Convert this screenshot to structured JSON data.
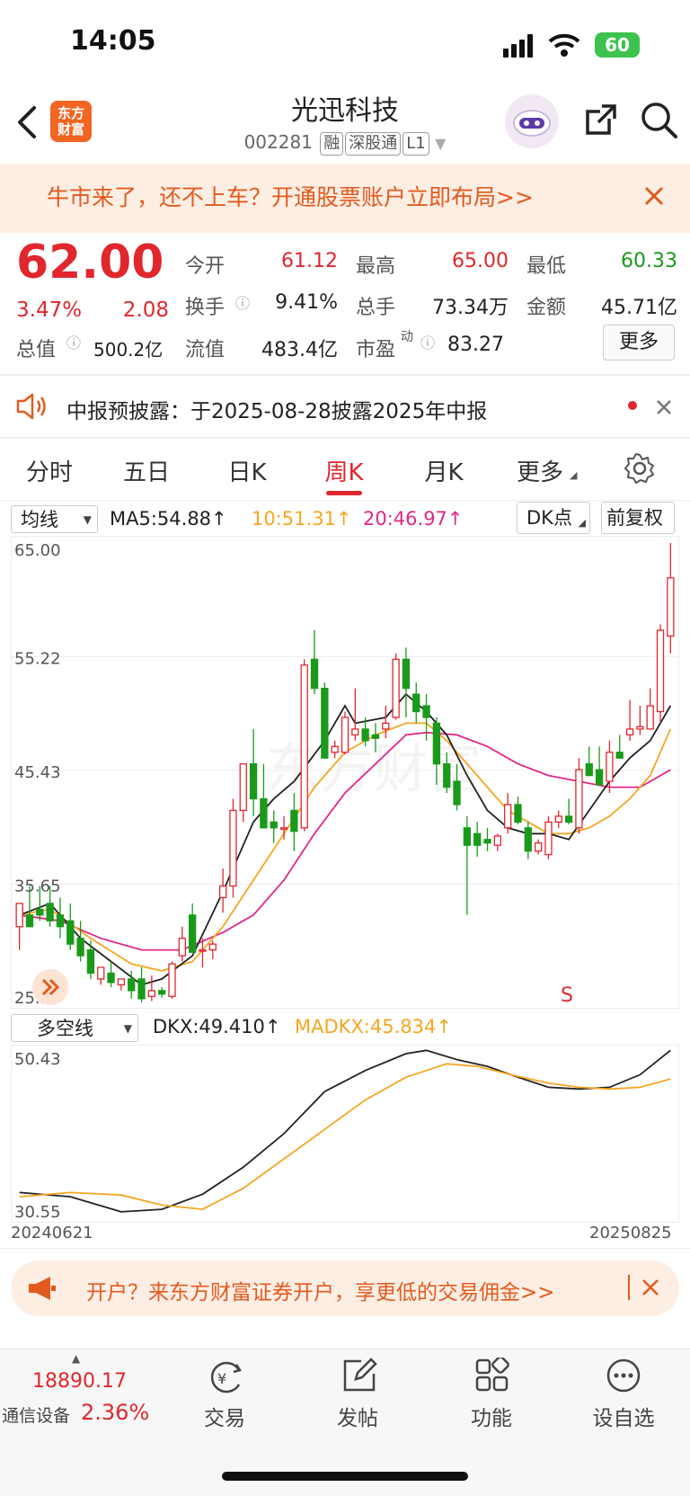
{
  "status_bar": {
    "time": "14:05",
    "battery": "60"
  },
  "header": {
    "title": "光迅科技",
    "code": "002281",
    "tags": [
      "融",
      "深股通",
      "L1"
    ],
    "logo_text": "东方\n财富"
  },
  "promo_top": {
    "text": "牛市来了，还不上车？开通股票账户立即布局>>"
  },
  "quote": {
    "price": "62.00",
    "change_pct": "3.47%",
    "change": "2.08",
    "open_label": "今开",
    "open": "61.12",
    "high_label": "最高",
    "high": "65.00",
    "low_label": "最低",
    "low": "60.33",
    "turnover_label": "换手",
    "turnover": "9.41%",
    "volume_label": "总手",
    "volume": "73.34万",
    "amount_label": "金额",
    "amount": "45.71亿",
    "total_value_label": "总值",
    "total_value": "500.2亿",
    "float_value_label": "流值",
    "float_value": "483.4亿",
    "pe_label": "市盈",
    "pe_sup": "动",
    "pe": "83.27",
    "more_label": "更多"
  },
  "notice": {
    "text": "中报预披露：于2025-08-28披露2025年中报"
  },
  "tabs": [
    "分时",
    "五日",
    "日K",
    "周K",
    "月K",
    "更多"
  ],
  "indicators": {
    "ma_select": "均线",
    "ma5": "MA5:54.88↑",
    "ma10": "10:51.31↑",
    "ma20": "20:46.97↑",
    "dk_button": "DK点",
    "adjust_button": "前复权",
    "dk_select": "多空线",
    "dkx": "DKX:49.410↑",
    "madkx": "MADKX:45.834↑"
  },
  "colors": {
    "up": "#e0272d",
    "down": "#1a9a1a",
    "ma5": "#222222",
    "ma10": "#f5a623",
    "ma20": "#e0288a",
    "accent": "#e25a1f"
  },
  "chart_data": [
    {
      "type": "candlestick",
      "title": "周K",
      "ylim": [
        25.56,
        65.0
      ],
      "ytick_labels": [
        "65.00",
        "55.22",
        "45.43",
        "35.65",
        "25.56"
      ],
      "marker": "S",
      "candles": [
        {
          "o": 32,
          "h": 33.5,
          "l": 30,
          "c": 34
        },
        {
          "o": 33,
          "h": 35.5,
          "l": 32,
          "c": 32
        },
        {
          "o": 33.5,
          "h": 35.5,
          "l": 32.5,
          "c": 33
        },
        {
          "o": 34,
          "h": 35.5,
          "l": 32,
          "c": 32.5
        },
        {
          "o": 33,
          "h": 34.5,
          "l": 31,
          "c": 32
        },
        {
          "o": 32.5,
          "h": 34,
          "l": 30,
          "c": 30.5
        },
        {
          "o": 31,
          "h": 32.5,
          "l": 29,
          "c": 29.5
        },
        {
          "o": 30,
          "h": 30.8,
          "l": 27.5,
          "c": 28
        },
        {
          "o": 27.5,
          "h": 28.5,
          "l": 27,
          "c": 28.5
        },
        {
          "o": 28,
          "h": 29,
          "l": 26.8,
          "c": 27.2
        },
        {
          "o": 27,
          "h": 27.5,
          "l": 26.5,
          "c": 27.5
        },
        {
          "o": 27.5,
          "h": 28.2,
          "l": 25.8,
          "c": 26.5
        },
        {
          "o": 27.5,
          "h": 28.5,
          "l": 25.5,
          "c": 25.8
        },
        {
          "o": 26,
          "h": 27.8,
          "l": 25.6,
          "c": 26.5
        },
        {
          "o": 26.5,
          "h": 26.8,
          "l": 25.9,
          "c": 26.2
        },
        {
          "o": 26,
          "h": 29,
          "l": 25.8,
          "c": 28.8
        },
        {
          "o": 29.5,
          "h": 32,
          "l": 29,
          "c": 31
        },
        {
          "o": 33,
          "h": 34,
          "l": 29.8,
          "c": 29.8
        },
        {
          "o": 30,
          "h": 31,
          "l": 28.5,
          "c": 30
        },
        {
          "o": 30,
          "h": 30.8,
          "l": 29.2,
          "c": 30.5
        },
        {
          "o": 34.5,
          "h": 37,
          "l": 33.2,
          "c": 35.5
        },
        {
          "o": 35.5,
          "h": 43,
          "l": 34.5,
          "c": 42
        },
        {
          "o": 42,
          "h": 46,
          "l": 41,
          "c": 46
        },
        {
          "o": 46,
          "h": 49,
          "l": 41.5,
          "c": 43
        },
        {
          "o": 43,
          "h": 46,
          "l": 40.5,
          "c": 40.5
        },
        {
          "o": 41,
          "h": 42,
          "l": 39.2,
          "c": 40.5
        },
        {
          "o": 40.5,
          "h": 41.5,
          "l": 39.5,
          "c": 40.5
        },
        {
          "o": 42,
          "h": 43.5,
          "l": 38.5,
          "c": 40.2
        },
        {
          "o": 40.5,
          "h": 55,
          "l": 40.2,
          "c": 54.5
        },
        {
          "o": 55,
          "h": 57.5,
          "l": 52,
          "c": 52.5
        },
        {
          "o": 52.5,
          "h": 53,
          "l": 46.5,
          "c": 46.5
        },
        {
          "o": 47,
          "h": 48,
          "l": 46.5,
          "c": 47.5
        },
        {
          "o": 47,
          "h": 50.5,
          "l": 46.8,
          "c": 50
        },
        {
          "o": 48.5,
          "h": 52.5,
          "l": 48,
          "c": 49
        },
        {
          "o": 49,
          "h": 50,
          "l": 47.5,
          "c": 48
        },
        {
          "o": 48.5,
          "h": 49.5,
          "l": 47,
          "c": 48.2
        },
        {
          "o": 49,
          "h": 51,
          "l": 48.2,
          "c": 49.5
        },
        {
          "o": 50,
          "h": 55.5,
          "l": 49.8,
          "c": 55
        },
        {
          "o": 55,
          "h": 56,
          "l": 50,
          "c": 52.5
        },
        {
          "o": 52,
          "h": 53,
          "l": 49.5,
          "c": 50.5
        },
        {
          "o": 51,
          "h": 52,
          "l": 48,
          "c": 50
        },
        {
          "o": 49.5,
          "h": 50,
          "l": 44.2,
          "c": 46
        },
        {
          "o": 46,
          "h": 47,
          "l": 43.5,
          "c": 44
        },
        {
          "o": 44.5,
          "h": 46,
          "l": 42,
          "c": 42.5
        },
        {
          "o": 40.5,
          "h": 41.5,
          "l": 33,
          "c": 39
        },
        {
          "o": 40,
          "h": 41,
          "l": 38,
          "c": 39
        },
        {
          "o": 39.5,
          "h": 40.5,
          "l": 38.5,
          "c": 39.2
        },
        {
          "o": 39,
          "h": 40,
          "l": 38.5,
          "c": 39.8
        },
        {
          "o": 40.5,
          "h": 43.5,
          "l": 40,
          "c": 42.5
        },
        {
          "o": 42.5,
          "h": 43.2,
          "l": 40.8,
          "c": 41
        },
        {
          "o": 40.5,
          "h": 41,
          "l": 37.8,
          "c": 38.5
        },
        {
          "o": 38.5,
          "h": 39.5,
          "l": 38.2,
          "c": 39.2
        },
        {
          "o": 38.2,
          "h": 41.5,
          "l": 37.8,
          "c": 41
        },
        {
          "o": 41,
          "h": 42,
          "l": 40.5,
          "c": 41.5
        },
        {
          "o": 41.5,
          "h": 43,
          "l": 40.8,
          "c": 41
        },
        {
          "o": 40.5,
          "h": 46.5,
          "l": 40,
          "c": 45.5
        },
        {
          "o": 46,
          "h": 47.5,
          "l": 45,
          "c": 45
        },
        {
          "o": 45.5,
          "h": 47.5,
          "l": 44.5,
          "c": 44.2
        },
        {
          "o": 44.5,
          "h": 48,
          "l": 43.5,
          "c": 47
        },
        {
          "o": 47,
          "h": 48.5,
          "l": 46.5,
          "c": 46.5
        },
        {
          "o": 48.5,
          "h": 51.5,
          "l": 48,
          "c": 49
        },
        {
          "o": 49,
          "h": 51,
          "l": 48.5,
          "c": 49.2
        },
        {
          "o": 49,
          "h": 52.5,
          "l": 49,
          "c": 51
        },
        {
          "o": 50.5,
          "h": 58,
          "l": 49.5,
          "c": 57.5
        },
        {
          "o": 57,
          "h": 65,
          "l": 55.5,
          "c": 62
        }
      ],
      "ma5": [
        [
          0,
          33
        ],
        [
          3,
          34
        ],
        [
          6,
          31
        ],
        [
          9,
          29
        ],
        [
          12,
          27
        ],
        [
          14,
          27.5
        ],
        [
          17,
          29.5
        ],
        [
          20,
          35
        ],
        [
          23,
          41
        ],
        [
          25,
          43
        ],
        [
          27,
          44.5
        ],
        [
          30,
          48
        ],
        [
          32,
          51
        ],
        [
          33,
          49.5
        ],
        [
          36,
          50
        ],
        [
          38,
          52
        ],
        [
          40,
          50.5
        ],
        [
          42,
          48.5
        ],
        [
          44,
          45
        ],
        [
          46,
          42
        ],
        [
          48,
          40.5
        ],
        [
          50,
          40
        ],
        [
          52,
          40
        ],
        [
          54,
          39.5
        ],
        [
          56,
          42
        ],
        [
          58,
          44.5
        ],
        [
          60,
          46.5
        ],
        [
          62,
          48
        ],
        [
          64,
          51
        ]
      ],
      "ma10": [
        [
          0,
          33
        ],
        [
          3,
          33.5
        ],
        [
          7,
          31
        ],
        [
          11,
          28.8
        ],
        [
          14,
          28.2
        ],
        [
          17,
          29
        ],
        [
          20,
          32
        ],
        [
          23,
          36
        ],
        [
          26,
          40
        ],
        [
          29,
          44
        ],
        [
          32,
          47
        ],
        [
          35,
          48.5
        ],
        [
          38,
          49.5
        ],
        [
          40,
          49.5
        ],
        [
          42,
          48
        ],
        [
          44,
          46
        ],
        [
          46,
          44
        ],
        [
          48,
          42
        ],
        [
          50,
          41
        ],
        [
          52,
          40
        ],
        [
          54,
          40
        ],
        [
          56,
          40.5
        ],
        [
          58,
          41.5
        ],
        [
          60,
          43
        ],
        [
          62,
          45
        ],
        [
          64,
          49
        ]
      ],
      "ma20": [
        [
          0,
          33
        ],
        [
          4,
          32.5
        ],
        [
          8,
          31
        ],
        [
          12,
          30
        ],
        [
          16,
          30
        ],
        [
          20,
          31.5
        ],
        [
          23,
          33
        ],
        [
          26,
          36
        ],
        [
          29,
          40
        ],
        [
          32,
          43.5
        ],
        [
          35,
          46
        ],
        [
          38,
          48.5
        ],
        [
          40,
          48.7
        ],
        [
          43,
          48.5
        ],
        [
          46,
          47.5
        ],
        [
          49,
          46
        ],
        [
          52,
          45
        ],
        [
          55,
          44.5
        ],
        [
          58,
          44
        ],
        [
          61,
          44
        ],
        [
          64,
          45.5
        ]
      ]
    },
    {
      "type": "line",
      "title": "多空线",
      "ylim": [
        30.55,
        50.43
      ],
      "ytick_labels": [
        "50.43",
        "30.55"
      ],
      "xtick_labels": [
        "20240621",
        "20250825"
      ],
      "series": [
        {
          "name": "DKX",
          "values": [
            [
              0,
              33.5
            ],
            [
              5,
              33
            ],
            [
              10,
              31.2
            ],
            [
              14,
              31.5
            ],
            [
              18,
              33.3
            ],
            [
              22,
              36.5
            ],
            [
              26,
              40.5
            ],
            [
              30,
              45.5
            ],
            [
              34,
              48
            ],
            [
              38,
              50
            ],
            [
              40,
              50.4
            ],
            [
              43,
              49.3
            ],
            [
              46,
              48.5
            ],
            [
              49,
              47.2
            ],
            [
              52,
              46
            ],
            [
              55,
              45.8
            ],
            [
              58,
              46
            ],
            [
              61,
              47.5
            ],
            [
              64,
              50.4
            ]
          ]
        },
        {
          "name": "MADKX",
          "values": [
            [
              0,
              33
            ],
            [
              5,
              33.5
            ],
            [
              10,
              33.2
            ],
            [
              14,
              32
            ],
            [
              18,
              31.5
            ],
            [
              22,
              34
            ],
            [
              26,
              37.5
            ],
            [
              30,
              41
            ],
            [
              34,
              44.5
            ],
            [
              38,
              47.2
            ],
            [
              42,
              48.8
            ],
            [
              45,
              48.5
            ],
            [
              49,
              47.3
            ],
            [
              52,
              46.5
            ],
            [
              55,
              46
            ],
            [
              58,
              45.8
            ],
            [
              61,
              46
            ],
            [
              64,
              47
            ]
          ]
        }
      ]
    }
  ],
  "promo_bottom": {
    "text": "开户？来东方财富证券开户，享更低的交易佣金>>"
  },
  "bottom_bar": {
    "index_value": "18890.17",
    "index_name": "通信设备",
    "index_change": "2.36%",
    "items": [
      "交易",
      "发帖",
      "功能",
      "设自选"
    ]
  }
}
